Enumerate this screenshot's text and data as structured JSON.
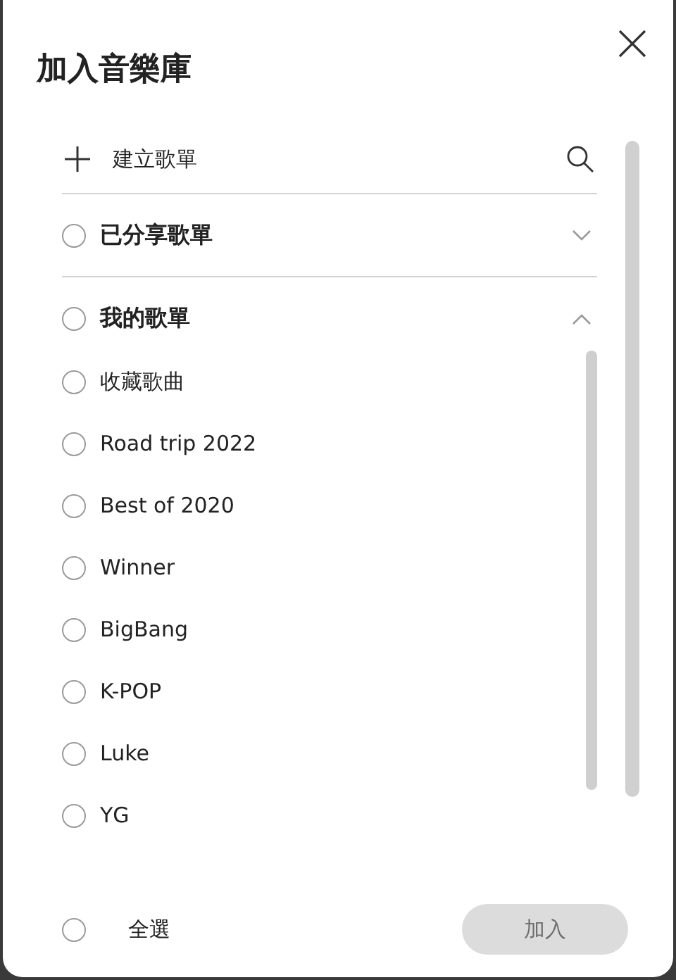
{
  "dialog": {
    "title": "加入音樂庫"
  },
  "create_row": {
    "label": "建立歌單"
  },
  "sections": [
    {
      "label": "已分享歌單",
      "checked": false,
      "expanded": false
    },
    {
      "label": "我的歌單",
      "checked": false,
      "expanded": true,
      "items": [
        {
          "label": "收藏歌曲",
          "checked": false
        },
        {
          "label": "Road trip 2022",
          "checked": false
        },
        {
          "label": "Best of 2020",
          "checked": false
        },
        {
          "label": "Winner",
          "checked": false
        },
        {
          "label": "BigBang",
          "checked": false
        },
        {
          "label": "K-POP",
          "checked": false
        },
        {
          "label": "Luke",
          "checked": false
        },
        {
          "label": "YG",
          "checked": false
        }
      ]
    }
  ],
  "footer": {
    "select_all": {
      "label": "全選",
      "checked": false
    },
    "add_button": {
      "label": "加入",
      "disabled": true
    }
  }
}
